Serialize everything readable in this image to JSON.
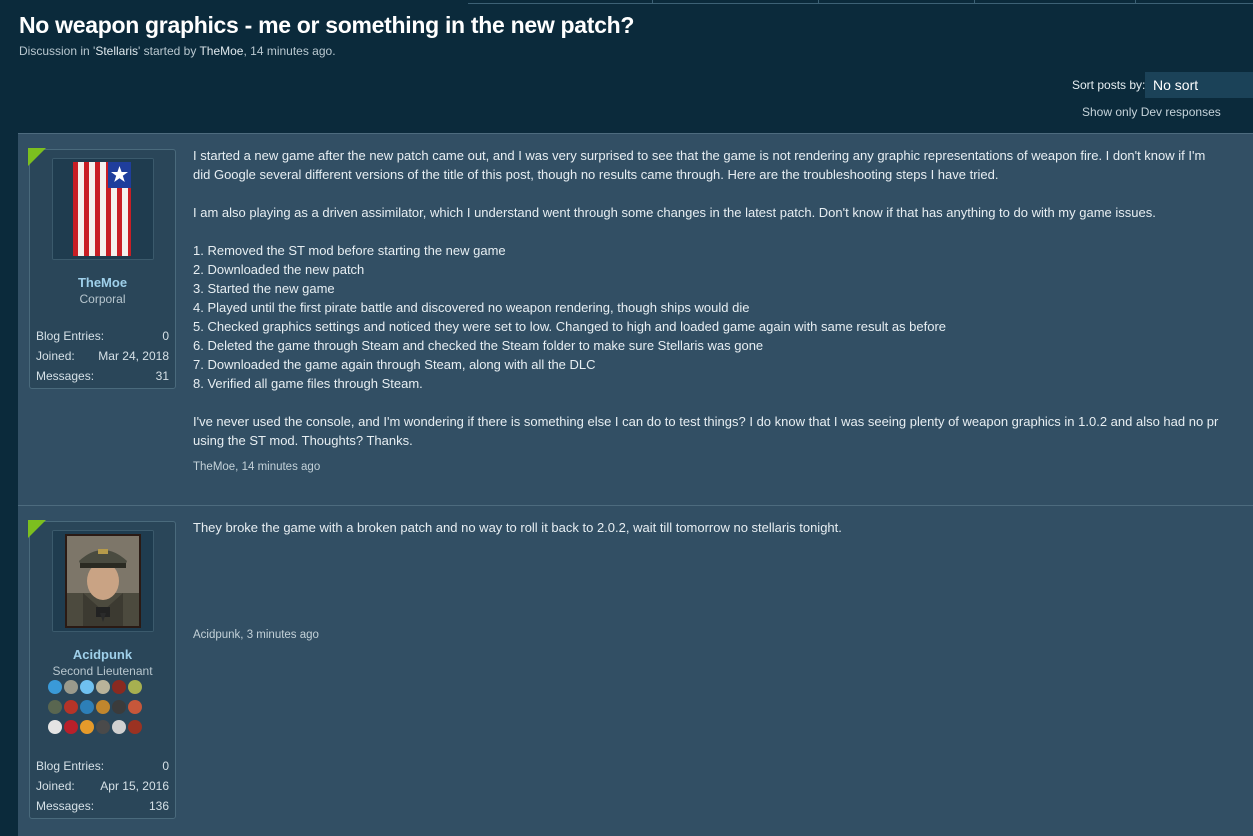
{
  "thread": {
    "title": "No weapon graphics - me or something in the new patch?",
    "meta_prefix": "Discussion in '",
    "forum": "Stellaris",
    "meta_mid": "' started by ",
    "starter": "TheMoe",
    "meta_suffix": ", 14 minutes ago."
  },
  "sort": {
    "label": "Sort posts by:",
    "selected": "No sort",
    "dev_link": "Show only Dev responses"
  },
  "posts": [
    {
      "user": {
        "name": "TheMoe",
        "rank": "Corporal",
        "avatar_icon": "flag-avatar-icon",
        "stats": [
          {
            "label": "Blog Entries:",
            "value": "0"
          },
          {
            "label": "Joined:",
            "value": "Mar 24, 2018"
          },
          {
            "label": "Messages:",
            "value": "31"
          }
        ]
      },
      "lines": [
        "I started a new game after the new patch came out, and I was very surprised to see that the game is not rendering any graphic representations of weapon fire. I don't know if I'm",
        "did Google several different versions of the title of this post, though no results came through. Here are the troubleshooting steps I have tried.",
        "",
        "I am also playing as a driven assimilator, which I understand went through some changes in the latest patch. Don't know if that has anything to do with my game issues.",
        "",
        "1. Removed the ST mod before starting the new game",
        "2. Downloaded the new patch",
        "3. Started the new game",
        "4. Played until the first pirate battle and discovered no weapon rendering, though ships would die",
        "5. Checked graphics settings and noticed they were set to low. Changed to high and loaded game again with same result as before",
        "6. Deleted the game through Steam and checked the Steam folder to make sure Stellaris was gone",
        "7. Downloaded the game again through Steam, along with all the DLC",
        "8. Verified all game files through Steam.",
        "",
        "I've never used the console, and I'm wondering if there is something else I can do to test things? I do know that I was seeing plenty of weapon graphics in 1.0.2 and also had no pr",
        "using the ST mod. Thoughts? Thanks."
      ],
      "signature": "TheMoe, 14 minutes ago"
    },
    {
      "user": {
        "name": "Acidpunk",
        "rank": "Second Lieutenant",
        "avatar_icon": "officer-portrait-avatar-icon",
        "stats": [
          {
            "label": "Blog Entries:",
            "value": "0"
          },
          {
            "label": "Joined:",
            "value": "Apr 15, 2016"
          },
          {
            "label": "Messages:",
            "value": "136"
          }
        ]
      },
      "lines": [
        "They broke the game with a broken patch and no way to roll it back to 2.0.2, wait till tomorrow no stellaris tonight."
      ],
      "signature": "Acidpunk, 3 minutes ago"
    }
  ],
  "colors": {
    "page_bg": "#0b2a3b",
    "post_bg": "#324f64",
    "user_box_bg": "#2a4659",
    "username": "#9fd0ea",
    "rank_corner": "#7cbf1f"
  }
}
